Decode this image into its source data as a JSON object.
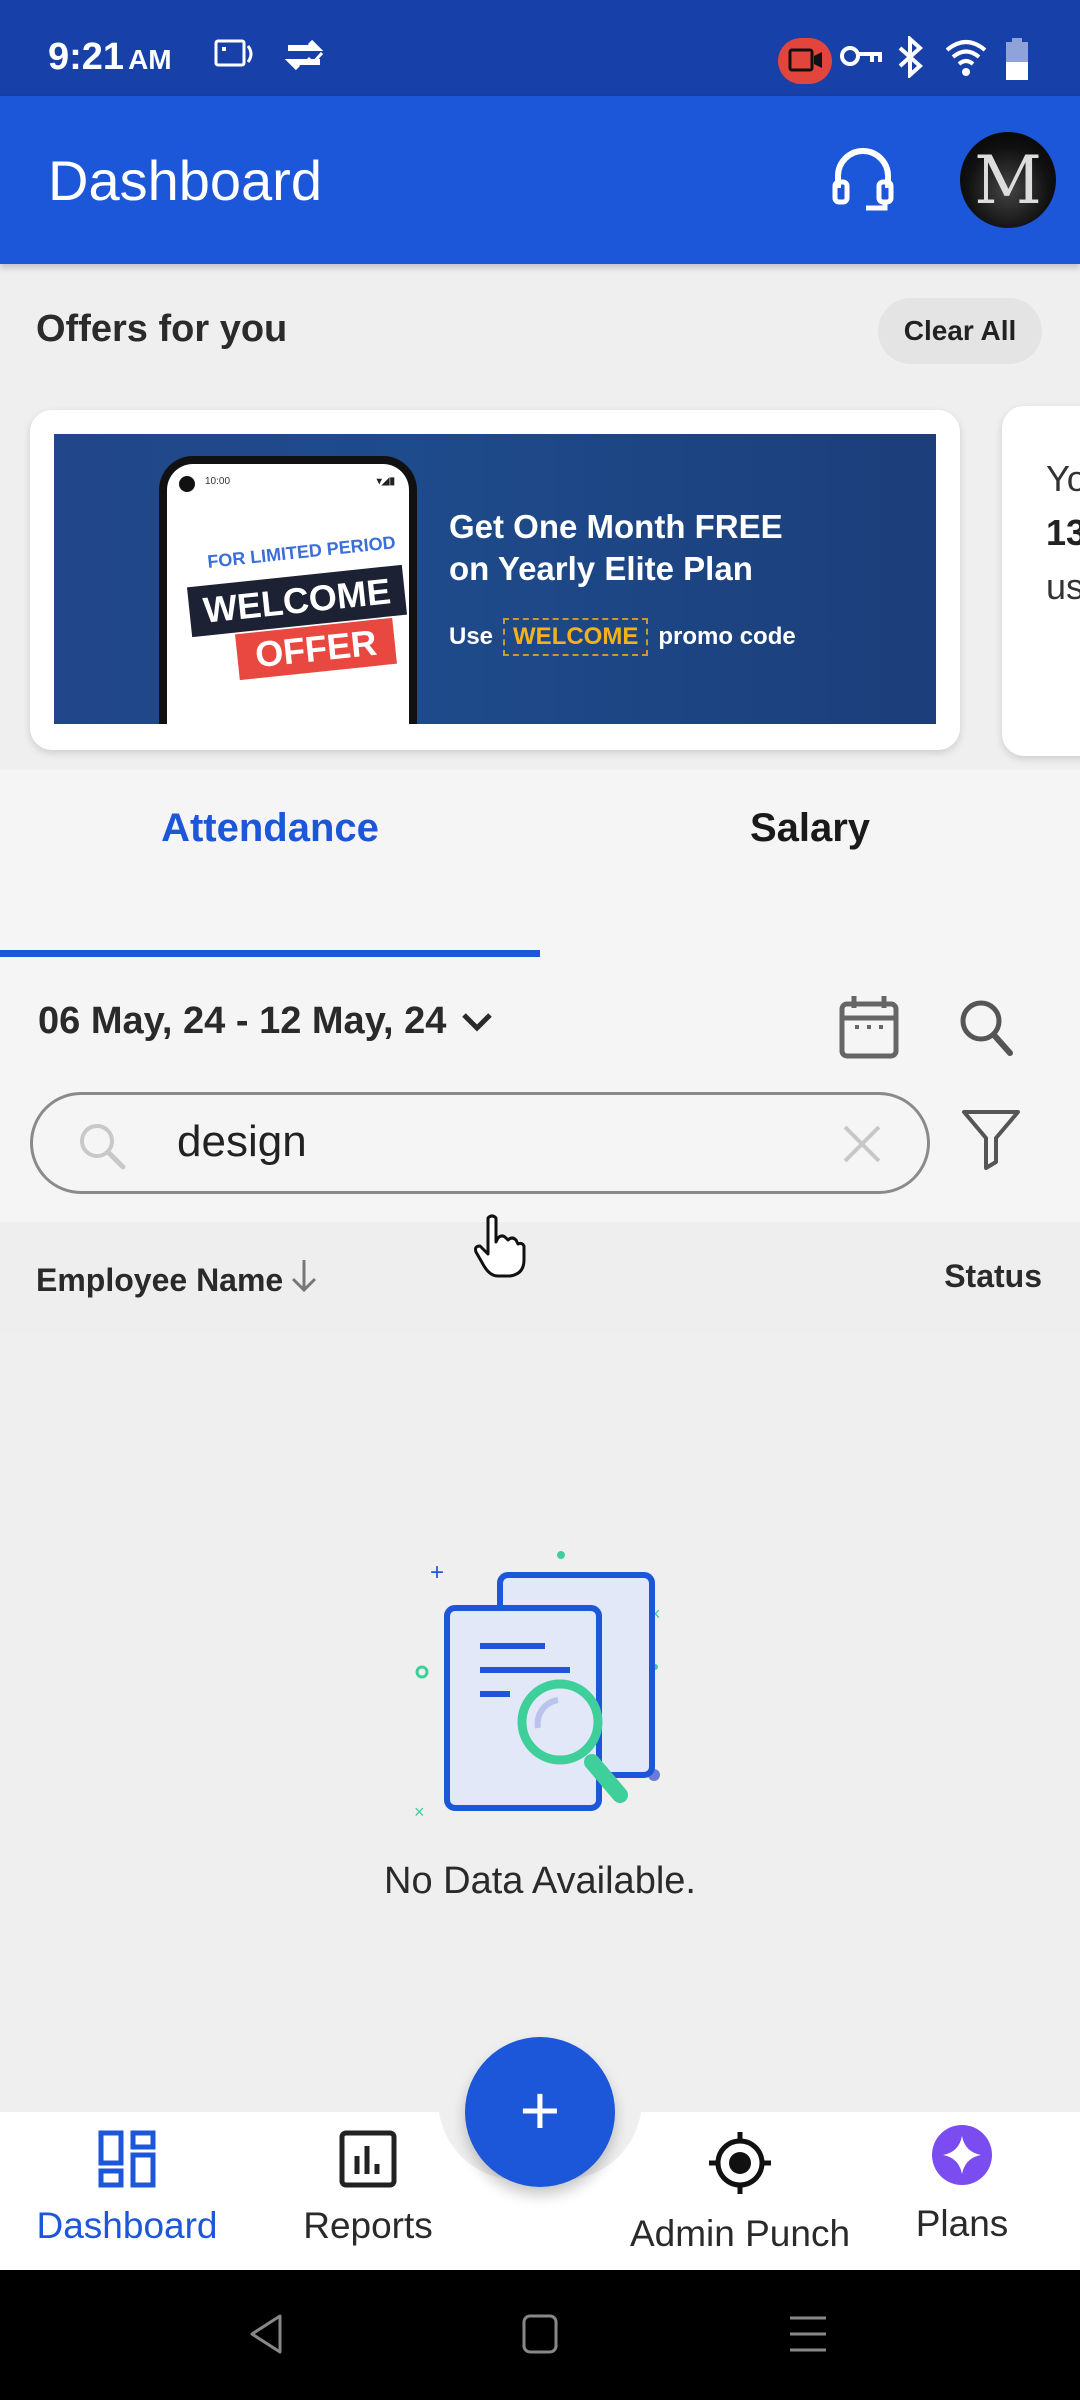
{
  "status_bar": {
    "time": "9:21",
    "ampm": "AM",
    "icons": [
      "screen-record-icon",
      "sync-check-icon",
      "camera-recording-icon",
      "vpn-key-icon",
      "bluetooth-icon",
      "wifi-icon",
      "battery-icon"
    ]
  },
  "app_bar": {
    "title": "Dashboard",
    "support_icon": "headset-icon",
    "avatar_letter": "M"
  },
  "offers": {
    "title": "Offers for you",
    "clear_all_label": "Clear All",
    "cards": [
      {
        "phone_time": "10:00",
        "tagline": "FOR LIMITED PERIOD",
        "tag_1": "WELCOME",
        "tag_2": "OFFER",
        "headline_1": "Get One Month FREE",
        "headline_2": "on Yearly Elite Plan",
        "promo_prefix": "Use",
        "promo_code": "WELCOME",
        "promo_suffix": "promo code"
      },
      {
        "line_1": "Yo",
        "line_2": "13",
        "line_3": "us"
      }
    ]
  },
  "tabs": [
    {
      "label": "Attendance",
      "active": true
    },
    {
      "label": "Salary",
      "active": false
    }
  ],
  "filters": {
    "date_range": "06 May, 24 - 12 May, 24",
    "search_value": "design",
    "search_placeholder": ""
  },
  "table": {
    "columns": [
      {
        "label": "Employee Name",
        "sort": "descending"
      },
      {
        "label": "Status"
      }
    ],
    "rows": []
  },
  "empty_state": {
    "message": "No Data Available."
  },
  "bottom_nav": {
    "items": [
      {
        "label": "Dashboard",
        "icon": "dashboard-grid-icon",
        "active": true
      },
      {
        "label": "Reports",
        "icon": "reports-chart-icon",
        "active": false
      },
      {
        "label": "Admin Punch",
        "icon": "target-icon",
        "active": false
      },
      {
        "label": "Plans",
        "icon": "sparkle-icon",
        "active": false
      }
    ],
    "fab_symbol": "+"
  },
  "colors": {
    "primary": "#1c56d9",
    "status_bar": "#1740a8",
    "accent_green": "#3ecf9a",
    "plans_purple": "#7b4cf0",
    "promo_yellow": "#f2b21c"
  }
}
